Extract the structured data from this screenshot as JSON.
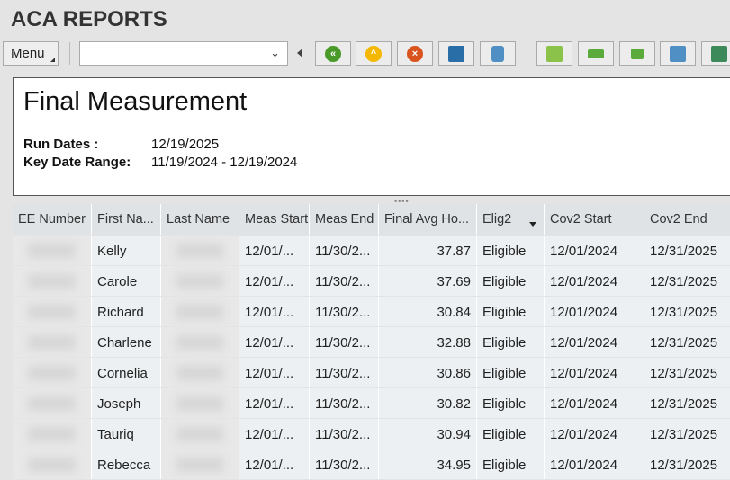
{
  "app": {
    "title": "ACA REPORTS"
  },
  "toolbar": {
    "menu_label": "Menu",
    "combo_value": "",
    "buttons": [
      "back-icon",
      "up-icon",
      "cancel-icon",
      "print-icon",
      "binoculars-icon",
      "preview-icon",
      "align-icon",
      "filter-list-icon",
      "filter-icon",
      "refresh-icon"
    ]
  },
  "report": {
    "title": "Final Measurement",
    "run_dates_label": "Run Dates :",
    "run_dates": "12/19/2025",
    "key_range_label": "Key Date Range:",
    "key_range": "11/19/2024 - 12/19/2024"
  },
  "table": {
    "columns": [
      "EE Number",
      "First Na...",
      "Last Name",
      "Meas Start",
      "Meas End",
      "Final Avg Ho...",
      "Elig2",
      "Cov2 Start",
      "Cov2 End"
    ],
    "rows": [
      {
        "first": "Kelly",
        "ms": "12/01/...",
        "me": "11/30/2...",
        "avg": "37.87",
        "elig": "Eligible",
        "cs": "12/01/2024",
        "ce": "12/31/2025"
      },
      {
        "first": "Carole",
        "ms": "12/01/...",
        "me": "11/30/2...",
        "avg": "37.69",
        "elig": "Eligible",
        "cs": "12/01/2024",
        "ce": "12/31/2025"
      },
      {
        "first": "Richard",
        "ms": "12/01/...",
        "me": "11/30/2...",
        "avg": "30.84",
        "elig": "Eligible",
        "cs": "12/01/2024",
        "ce": "12/31/2025"
      },
      {
        "first": "Charlene",
        "ms": "12/01/...",
        "me": "11/30/2...",
        "avg": "32.88",
        "elig": "Eligible",
        "cs": "12/01/2024",
        "ce": "12/31/2025"
      },
      {
        "first": "Cornelia",
        "ms": "12/01/...",
        "me": "11/30/2...",
        "avg": "30.86",
        "elig": "Eligible",
        "cs": "12/01/2024",
        "ce": "12/31/2025"
      },
      {
        "first": "Joseph",
        "ms": "12/01/...",
        "me": "11/30/2...",
        "avg": "30.82",
        "elig": "Eligible",
        "cs": "12/01/2024",
        "ce": "12/31/2025"
      },
      {
        "first": "Tauriq",
        "ms": "12/01/...",
        "me": "11/30/2...",
        "avg": "30.94",
        "elig": "Eligible",
        "cs": "12/01/2024",
        "ce": "12/31/2025"
      },
      {
        "first": "Rebecca",
        "ms": "12/01/...",
        "me": "11/30/2...",
        "avg": "34.95",
        "elig": "Eligible",
        "cs": "12/01/2024",
        "ce": "12/31/2025"
      }
    ]
  }
}
